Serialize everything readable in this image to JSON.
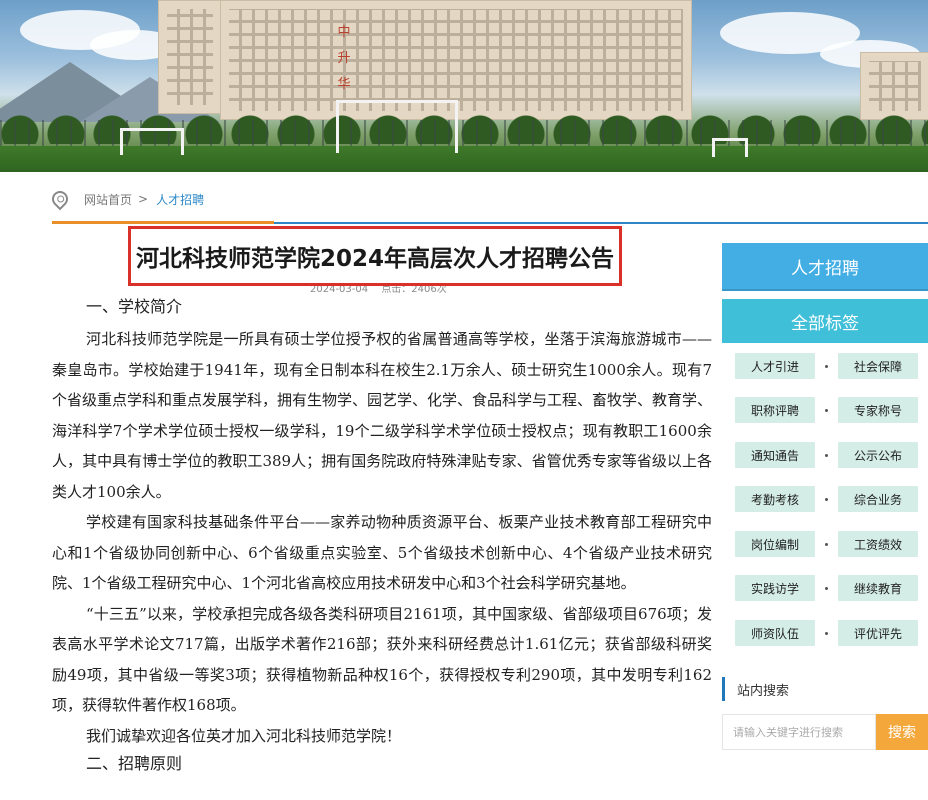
{
  "banner": {
    "building_letters": "中升华"
  },
  "breadcrumb": {
    "home": "网站首页",
    "separator": ">",
    "current": "人才招聘"
  },
  "article": {
    "title": "河北科技师范学院2024年高层次人才招聘公告",
    "date": "2024-03-04",
    "views": "点击：2406次",
    "section1": "一、学校简介",
    "paragraphs": [
      "河北科技师范学院是一所具有硕士学位授予权的省属普通高等学校，坐落于滨海旅游城市——秦皇岛市。学校始建于1941年，现有全日制本科在校生2.1万余人、硕士研究生1000余人。现有7个省级重点学科和重点发展学科，拥有生物学、园艺学、化学、食品科学与工程、畜牧学、教育学、海洋科学7个学术学位硕士授权一级学科，19个二级学科学术学位硕士授权点；现有教职工1600余人，其中具有博士学位的教职工389人；拥有国务院政府特殊津贴专家、省管优秀专家等省级以上各类人才100余人。",
      "学校建有国家科技基础条件平台——家养动物种质资源平台、板栗产业技术教育部工程研究中心和1个省级协同创新中心、6个省级重点实验室、5个省级技术创新中心、4个省级产业技术研究院、1个省级工程研究中心、1个河北省高校应用技术研发中心和3个社会科学研究基地。",
      "“十三五”以来，学校承担完成各级各类科研项目2161项，其中国家级、省部级项目676项；发表高水平学术论文717篇，出版学术著作216部；获外来科研经费总计1.61亿元；获省部级科研奖励49项，其中省级一等奖3项；获得植物新品种权16个，获得授权专利290项，其中发明专利162项，获得软件著作权168项。",
      "我们诚挚欢迎各位英才加入河北科技师范学院！"
    ],
    "section2": "二、招聘原则"
  },
  "sidebar": {
    "recruit_title": "人才招聘",
    "tags_title": "全部标签",
    "tags": [
      "人才引进",
      "社会保障",
      "职称评聘",
      "专家称号",
      "通知通告",
      "公示公布",
      "考勤考核",
      "综合业务",
      "岗位编制",
      "工资绩效",
      "实践访学",
      "继续教育",
      "师资队伍",
      "评优评先"
    ],
    "search_title": "站内搜索",
    "search_placeholder": "请输入关键字进行搜索",
    "search_button": "搜索"
  },
  "colors": {
    "accent_orange": "#e88f2a",
    "accent_blue": "#2f84c4",
    "title_border": "#d9302a",
    "sidebar_blue": "#42aee3",
    "sidebar_teal": "#3fbfd8",
    "tag_bg": "#d4ede6",
    "search_button": "#f4a83c"
  },
  "icons": {
    "breadcrumb": "location-pin-icon"
  }
}
